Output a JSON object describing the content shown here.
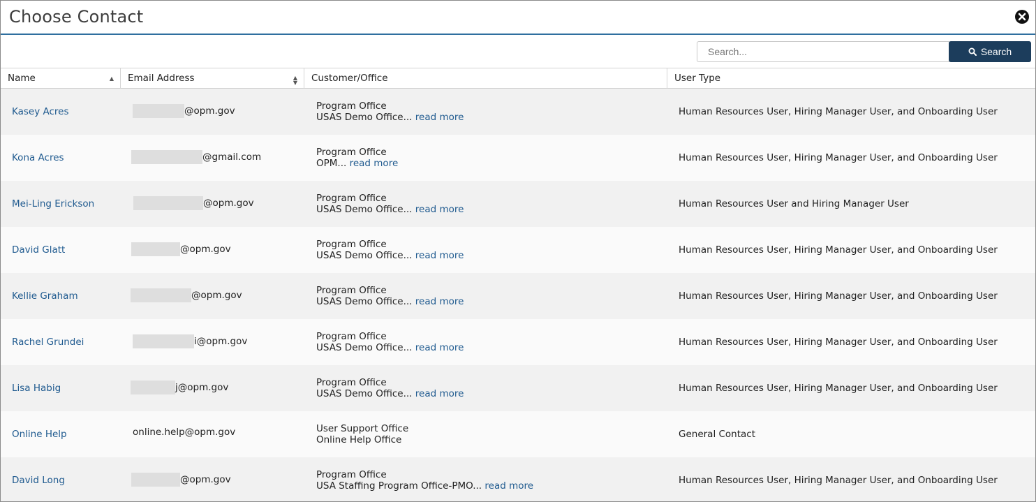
{
  "dialog": {
    "title": "Choose Contact",
    "close_icon": "close-circle-icon"
  },
  "search": {
    "placeholder": "Search...",
    "value": "",
    "button_label": "Search",
    "button_icon": "magnifier-icon"
  },
  "columns": [
    {
      "label": "Name",
      "sort": "ascending"
    },
    {
      "label": "Email Address",
      "sort": "sortable"
    },
    {
      "label": "Customer/Office",
      "sort": "none"
    },
    {
      "label": "User Type",
      "sort": "none"
    }
  ],
  "rows": [
    {
      "name": "Kasey Acres",
      "email_visible": "@opm.gov",
      "email_redacted": true,
      "office_type": "Program Office",
      "office_name": "USAS Demo Office...",
      "read_more": "read more",
      "user_type": "Human Resources User, Hiring Manager User, and Onboarding User"
    },
    {
      "name": "Kona Acres",
      "email_visible": "@gmail.com",
      "email_redacted": true,
      "office_type": "Program Office",
      "office_name": "OPM...",
      "read_more": "read more",
      "user_type": "Human Resources User, Hiring Manager User, and Onboarding User"
    },
    {
      "name": "Mei-Ling Erickson",
      "email_visible": "@opm.gov",
      "email_redacted": true,
      "office_type": "Program Office",
      "office_name": "USAS Demo Office...",
      "read_more": "read more",
      "user_type": "Human Resources User and Hiring Manager User"
    },
    {
      "name": "David Glatt",
      "email_visible": "@opm.gov",
      "email_redacted": true,
      "office_type": "Program Office",
      "office_name": "USAS Demo Office...",
      "read_more": "read more",
      "user_type": "Human Resources User, Hiring Manager User, and Onboarding User"
    },
    {
      "name": "Kellie Graham",
      "email_visible": "@opm.gov",
      "email_redacted": true,
      "office_type": "Program Office",
      "office_name": "USAS Demo Office...",
      "read_more": "read more",
      "user_type": "Human Resources User, Hiring Manager User, and Onboarding User"
    },
    {
      "name": "Rachel Grundei",
      "email_visible": "i@opm.gov",
      "email_redacted": true,
      "office_type": "Program Office",
      "office_name": "USAS Demo Office...",
      "read_more": "read more",
      "user_type": "Human Resources User, Hiring Manager User, and Onboarding User"
    },
    {
      "name": "Lisa Habig",
      "email_visible": "j@opm.gov",
      "email_redacted": true,
      "office_type": "Program Office",
      "office_name": "USAS Demo Office...",
      "read_more": "read more",
      "user_type": "Human Resources User, Hiring Manager User, and Onboarding User"
    },
    {
      "name": "Online Help",
      "email_visible": "online.help@opm.gov",
      "email_redacted": false,
      "office_type": "User Support Office",
      "office_name": "Online Help Office",
      "read_more": "",
      "user_type": "General Contact"
    },
    {
      "name": "David Long",
      "email_visible": "@opm.gov",
      "email_redacted": true,
      "office_type": "Program Office",
      "office_name": "USA Staffing Program Office-PMO...",
      "read_more": "read more",
      "user_type": "Human Resources User, Hiring Manager User, and Onboarding User"
    }
  ]
}
